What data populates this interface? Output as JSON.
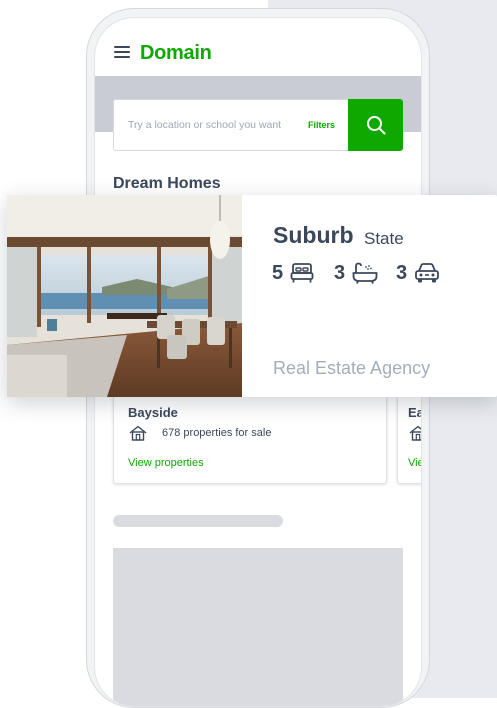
{
  "app": {
    "logo": "Domain"
  },
  "search": {
    "placeholder": "Try a location or school you want",
    "filters_label": "Filters"
  },
  "section": {
    "title": "Dream Homes"
  },
  "cards": [
    {
      "name": "Bayside",
      "count": "678 properties for sale",
      "link": "View properties"
    },
    {
      "name": "Ea",
      "count": "",
      "link": "Vie"
    }
  ],
  "listing": {
    "suburb": "Suburb",
    "state": "State",
    "beds": "5",
    "baths": "3",
    "cars": "3",
    "agency": "Real Estate Agency"
  },
  "icons": {
    "menu": "hamburger-icon",
    "search": "search-icon",
    "house": "house-icon",
    "bed": "bed-icon",
    "bath": "bath-icon",
    "car": "car-icon"
  },
  "colors": {
    "brand_green": "#0ea800",
    "text_dark": "#3c475b",
    "muted": "#a7adb8"
  }
}
